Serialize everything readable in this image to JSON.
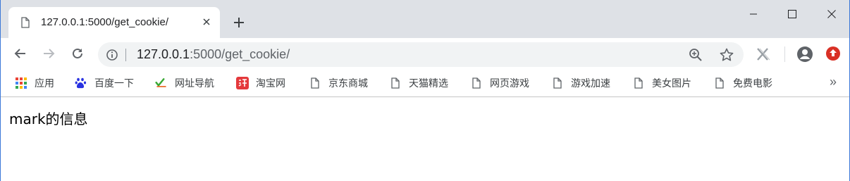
{
  "tab": {
    "title": "127.0.0.1:5000/get_cookie/"
  },
  "window_controls": {
    "minimize_icon": "minimize-icon",
    "maximize_icon": "maximize-icon",
    "close_icon": "close-icon"
  },
  "toolbar": {
    "url_host": "127.0.0.1",
    "url_rest": ":5000/get_cookie/"
  },
  "bookmarks": [
    {
      "label": "应用",
      "icon": "apps-grid-icon"
    },
    {
      "label": "百度一下",
      "icon": "baidu-paw-icon"
    },
    {
      "label": "网址导航",
      "icon": "hao-icon"
    },
    {
      "label": "淘宝网",
      "icon": "taobao-icon"
    },
    {
      "label": "京东商城",
      "icon": "page-icon"
    },
    {
      "label": "天猫精选",
      "icon": "page-icon"
    },
    {
      "label": "网页游戏",
      "icon": "page-icon"
    },
    {
      "label": "游戏加速",
      "icon": "page-icon"
    },
    {
      "label": "美女图片",
      "icon": "page-icon"
    },
    {
      "label": "免费电影",
      "icon": "page-icon"
    }
  ],
  "bookmarks_more": "»",
  "page": {
    "text": "mark的信息"
  },
  "colors": {
    "tabstrip": "#dee1e6",
    "omnibox": "#f1f3f4",
    "update_badge": "#d93025",
    "window_border": "#3c78d8"
  }
}
